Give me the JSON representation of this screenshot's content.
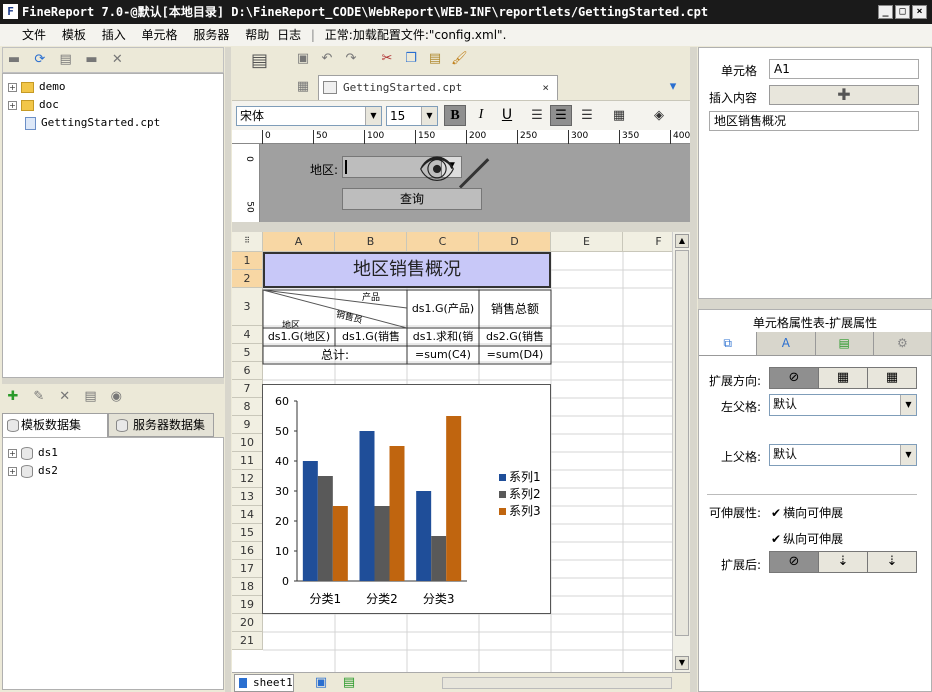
{
  "window": {
    "title": "FineReport 7.0-@默认[本地目录]    D:\\FineReport_CODE\\WebReport\\WEB-INF\\reportlets/GettingStarted.cpt",
    "logo": "F"
  },
  "menu": [
    "文件",
    "模板",
    "插入",
    "单元格",
    "服务器",
    "帮助",
    "日志"
  ],
  "status": "正常:加载配置文件:\"config.xml\".",
  "tree": {
    "items": [
      {
        "label": "demo",
        "type": "folder"
      },
      {
        "label": "doc",
        "type": "folder"
      },
      {
        "label": "GettingStarted.cpt",
        "type": "file"
      }
    ]
  },
  "dataset": {
    "tabs": [
      "模板数据集",
      "服务器数据集"
    ],
    "items": [
      "ds1",
      "ds2"
    ]
  },
  "editor": {
    "tab_label": "GettingStarted.cpt",
    "font_name": "宋体",
    "font_size": "15",
    "bold": "B",
    "italic": "I",
    "underline": "U"
  },
  "ruler": [
    "0",
    "50",
    "100",
    "150",
    "200",
    "250",
    "300",
    "350",
    "400"
  ],
  "vruler": [
    "0",
    "50"
  ],
  "param": {
    "label": "地区:",
    "query_button": "查询"
  },
  "sheet": {
    "cols": [
      "A",
      "B",
      "C",
      "D",
      "E",
      "F"
    ],
    "rows": [
      "1",
      "2",
      "3",
      "4",
      "5",
      "6",
      "7",
      "8",
      "9",
      "10",
      "11",
      "12",
      "13",
      "14",
      "15",
      "16",
      "17",
      "18",
      "19",
      "20",
      "21"
    ],
    "title": "地区销售概况",
    "diag_product": "产品",
    "diag_sales": "销售员",
    "diag_region": "地区",
    "c3": "ds1.G(产品)",
    "d3": "销售总额",
    "a4": "ds1.G(地区)",
    "b4": "ds1.G(销售",
    "c4": "ds1.求和(销",
    "d4": "ds2.G(销售",
    "total_label": "总计:",
    "c5": "=sum(C4)",
    "d5": "=sum(D4)",
    "sheet_tab": "sheet1"
  },
  "chart_data": {
    "type": "bar",
    "categories": [
      "分类1",
      "分类2",
      "分类3"
    ],
    "series": [
      {
        "name": "系列1",
        "values": [
          40,
          50,
          30
        ],
        "color": "#1f4e99"
      },
      {
        "name": "系列2",
        "values": [
          35,
          25,
          15
        ],
        "color": "#595959"
      },
      {
        "name": "系列3",
        "values": [
          25,
          45,
          55
        ],
        "color": "#c0650f"
      }
    ],
    "ylim": [
      0,
      60
    ],
    "yticks": [
      "0",
      "10",
      "20",
      "30",
      "40",
      "50",
      "60"
    ],
    "legend": "right",
    "grid": false
  },
  "props": {
    "cell_label": "单元格",
    "cell_value": "A1",
    "insert_label": "插入内容",
    "content_value": "地区销售概况",
    "section_title": "单元格属性表-扩展属性",
    "expand_dir_label": "扩展方向:",
    "left_parent_label": "左父格:",
    "left_parent_value": "默认",
    "top_parent_label": "上父格:",
    "top_parent_value": "默认",
    "stretch_label": "可伸展性:",
    "h_stretch": "横向可伸展",
    "v_stretch": "纵向可伸展",
    "after_expand_label": "扩展后:"
  }
}
